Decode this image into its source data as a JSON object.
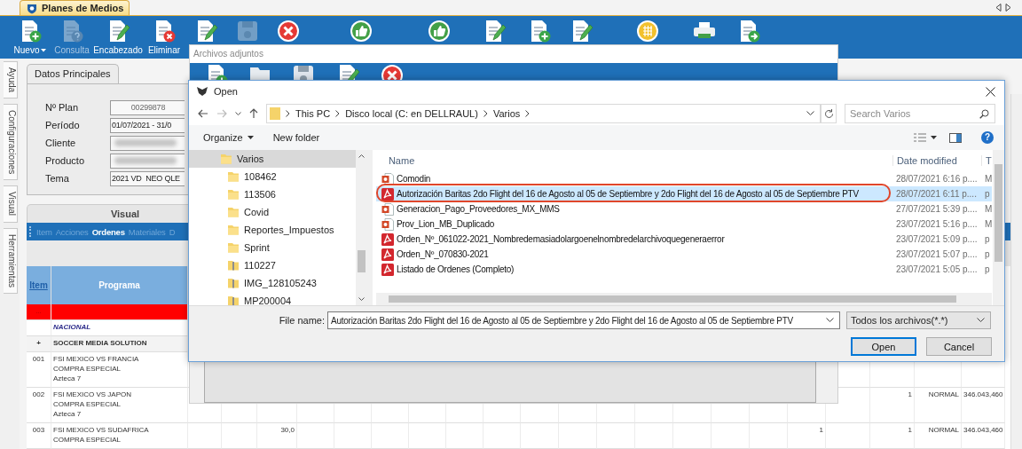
{
  "app_tab": {
    "label": "Planes de Medios"
  },
  "toolbar": [
    {
      "kind": "doc-plus",
      "label": "Nuevo",
      "dropdown": true,
      "disabled": false
    },
    {
      "kind": "doc-help",
      "label": "Consulta",
      "dropdown": false,
      "disabled": true
    },
    {
      "kind": "doc-pencil",
      "label": "Encabezado",
      "dropdown": false,
      "disabled": false
    },
    {
      "kind": "doc-delete",
      "label": "Eliminar",
      "dropdown": false,
      "disabled": false
    },
    {
      "kind": "doc-pencil",
      "dropdown": false,
      "disabled": false
    },
    {
      "kind": "disk",
      "dropdown": false,
      "disabled": true
    },
    {
      "kind": "cancel",
      "dropdown": false,
      "disabled": false
    },
    {
      "kind": "thumb",
      "dropdown": false,
      "disabled": false
    },
    {
      "kind": "thumb",
      "dropdown": false,
      "disabled": false
    },
    {
      "kind": "doc-pencil",
      "dropdown": false,
      "disabled": false
    },
    {
      "kind": "doc-plus",
      "dropdown": false,
      "disabled": false
    },
    {
      "kind": "doc-pencil",
      "dropdown": false,
      "disabled": false
    },
    {
      "kind": "grid",
      "dropdown": false,
      "disabled": false
    },
    {
      "kind": "printer",
      "dropdown": false,
      "disabled": false
    },
    {
      "kind": "doc-export",
      "dropdown": false,
      "disabled": false
    }
  ],
  "side_tabs": [
    "Ayuda",
    "Configuraciones",
    "Visual",
    "Herramientas"
  ],
  "datos_principales": {
    "title": "Datos Principales",
    "fields": [
      {
        "label": "Nº Plan",
        "kind": "readonly",
        "value": "00299878"
      },
      {
        "label": "Período",
        "kind": "text",
        "value": "01/07/2021 - 31/0"
      },
      {
        "label": "Cliente",
        "kind": "redacted"
      },
      {
        "label": "Producto",
        "kind": "redacted"
      },
      {
        "label": "Tema",
        "kind": "text",
        "value": "2021 VD  NEO QLE"
      }
    ]
  },
  "visual": {
    "title": "Visual",
    "menu": [
      {
        "label": "Item",
        "selected": false
      },
      {
        "label": "Acciones",
        "selected": false
      },
      {
        "label": "Ordenes",
        "selected": true
      },
      {
        "label": "Materiales",
        "selected": false
      },
      {
        "label": "D",
        "selected": false
      }
    ],
    "table": {
      "columns": [
        {
          "label": "Item",
          "kind": "link"
        },
        {
          "label": "Programa",
          "kind": "plain"
        }
      ],
      "rows": [
        {
          "kind": "marker",
          "item": "..."
        },
        {
          "kind": "group",
          "programa": [
            "NACIONAL"
          ]
        },
        {
          "kind": "section",
          "item": "+",
          "programa": [
            "SOCCER MEDIA SOLUTION"
          ]
        },
        {
          "kind": "item",
          "item": "001",
          "programa": [
            "FSI MEXICO VS FRANCIA",
            "COMPRA ESPECIAL",
            "Azteca 7"
          ]
        },
        {
          "kind": "item",
          "item": "002",
          "programa": [
            "FSI MEXICO VS JAPON",
            "COMPRA ESPECIAL",
            "Azteca 7"
          ],
          "column_21": "1",
          "column_22": "NORMAL",
          "column_23": "346.043,460"
        },
        {
          "kind": "item",
          "item": "003",
          "programa": [
            "FSI MEXICO VS SUDAFRICA",
            "COMPRA ESPECIAL"
          ],
          "column_5": "30,0",
          "column_19": "1",
          "column_21": "1",
          "column_22": "NORMAL",
          "column_23": "346.043,460"
        }
      ]
    }
  },
  "attachments_window": {
    "title": "Archivos adjuntos",
    "tools": [
      {
        "kind": "doc-plus"
      },
      {
        "kind": "folder"
      },
      {
        "kind": "disk"
      },
      {
        "kind": "doc-edit"
      },
      {
        "kind": "cancel"
      }
    ]
  },
  "open_dialog": {
    "title": "Open",
    "path": [
      "This PC",
      "Disco local (C: en DELLRAUL)",
      "Varios"
    ],
    "search": {
      "placeholder": "Search Varios"
    },
    "commands": [
      {
        "label": "Organize",
        "dropdown": true
      },
      {
        "label": "New folder",
        "dropdown": false
      }
    ],
    "help": "?",
    "nav_tree": [
      {
        "label": "Varios",
        "kind": "folder",
        "selected": true,
        "children": [
          {
            "label": "108462",
            "kind": "folder",
            "selected": false
          },
          {
            "label": "113506",
            "kind": "folder",
            "selected": false
          },
          {
            "label": "Covid",
            "kind": "folder",
            "selected": false
          },
          {
            "label": "Reportes_Impuestos",
            "kind": "folder",
            "selected": false
          },
          {
            "label": "Sprint",
            "kind": "folder",
            "selected": false
          },
          {
            "label": "110227",
            "kind": "zip",
            "selected": false
          },
          {
            "label": "IMG_128105243",
            "kind": "zip",
            "selected": false
          },
          {
            "label": "MP200004",
            "kind": "zip",
            "selected": false
          }
        ]
      }
    ],
    "columns": [
      "Name",
      "Date modified",
      "T"
    ],
    "files": [
      {
        "name": "Comodin",
        "kind": "ppt",
        "date": "28/07/2021 6:16 p....",
        "type": "M",
        "selected": false,
        "circled": false
      },
      {
        "name": "Autorización Baritas 2do Flight del 16 de Agosto al 05 de Septiembre y 2do Flight del 16 de Agosto al 05 de Septiembre PTV",
        "kind": "pdf",
        "date": "28/07/2021 6:11 p....",
        "type": "p",
        "selected": true,
        "circled": true
      },
      {
        "name": "Generacion_Pago_Proveedores_MX_MMS",
        "kind": "ppt",
        "date": "27/07/2021 5:39 p....",
        "type": "M",
        "selected": false,
        "circled": false
      },
      {
        "name": "Prov_Lion_MB_Duplicado",
        "kind": "ppt",
        "date": "23/07/2021 5:16 p....",
        "type": "M",
        "selected": false,
        "circled": false
      },
      {
        "name": "Orden_Nº_061022-2021_Nombredemasiadolargoenelnombredelarchivoquegeneraerror",
        "kind": "pdf",
        "date": "23/07/2021 5:09 p....",
        "type": "p",
        "selected": false,
        "circled": false
      },
      {
        "name": "Orden_Nº_070830-2021",
        "kind": "pdf",
        "date": "23/07/2021 5:07 p....",
        "type": "p",
        "selected": false,
        "circled": false
      },
      {
        "name": "Listado de Ordenes (Completo)",
        "kind": "pdf",
        "date": "23/07/2021 5:05 p....",
        "type": "p",
        "selected": false,
        "circled": false
      }
    ],
    "file_name": {
      "label": "File name:",
      "value": "Autorización Baritas 2do Flight del 16 de Agosto al 05 de Septiembre y 2do Flight del 16 de Agosto al 05 de Septiembre PTV"
    },
    "file_type": "Todos los archivos(*.*)",
    "buttons": [
      {
        "label": "Open",
        "default": true
      },
      {
        "label": "Cancel",
        "default": false
      }
    ]
  }
}
